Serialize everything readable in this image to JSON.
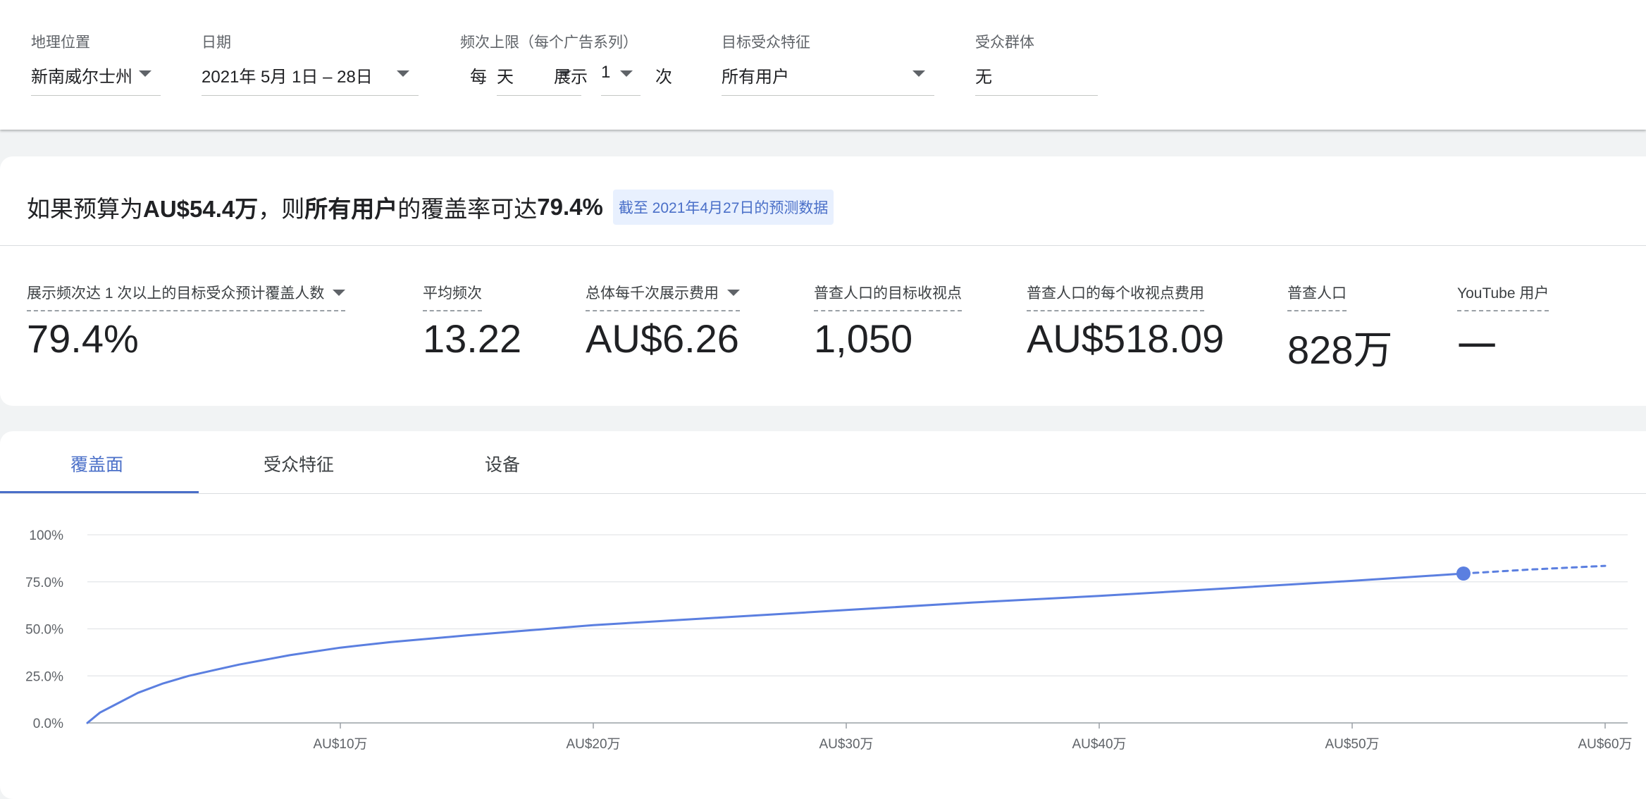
{
  "filters": {
    "geo": {
      "label": "地理位置",
      "value": "新南威尔士州"
    },
    "date": {
      "label": "日期",
      "value": "2021年 5月 1日 – 28日"
    },
    "frequency": {
      "label": "频次上限（每个广告系列）",
      "every": "每",
      "period": "天",
      "show": "展示",
      "count": "1",
      "unit": "次"
    },
    "audience": {
      "label": "目标受众特征",
      "value": "所有用户"
    },
    "segments": {
      "label": "受众群体",
      "value": "无"
    }
  },
  "summary": {
    "prefix": "如果预算为 ",
    "budget": "AU$54.4万",
    "mid": "，则",
    "audience": "所有用户",
    "mid2": "的覆盖率可达 ",
    "rate": "79.4%",
    "badge": "截至 2021年4月27日的预测数据"
  },
  "metrics": [
    {
      "label": "展示频次达 1 次以上的目标受众预计覆盖人数",
      "value": "79.4%"
    },
    {
      "label": "平均频次",
      "value": "13.22"
    },
    {
      "label": "总体每千次展示费用",
      "value": "AU$6.26"
    },
    {
      "label": "普查人口的目标收视点",
      "value": "1,050"
    },
    {
      "label": "普查人口的每个收视点费用",
      "value": "AU$518.09"
    },
    {
      "label": "普查人口",
      "value": "828万"
    },
    {
      "label": "YouTube 用户",
      "value": "一"
    }
  ],
  "tabs": [
    "覆盖面",
    "受众特征",
    "设备"
  ],
  "colors": {
    "accent": "#5b7fe0",
    "badge_bg": "#e8f0fe"
  },
  "chart_data": {
    "type": "line",
    "title": "",
    "xlabel": "",
    "ylabel": "",
    "x_unit": "AU$万",
    "xlim": [
      0,
      60
    ],
    "ylim": [
      0,
      100
    ],
    "x_ticks": [
      10,
      20,
      30,
      40,
      50,
      60
    ],
    "x_tick_labels": [
      "AU$10万",
      "AU$20万",
      "AU$30万",
      "AU$40万",
      "AU$50万",
      "AU$60万"
    ],
    "y_ticks": [
      0,
      25,
      50,
      75,
      100
    ],
    "y_tick_labels": [
      "0.0%",
      "25.0%",
      "50.0%",
      "75.0%",
      "100%"
    ],
    "grid": true,
    "series": [
      {
        "style": "solid",
        "x": [
          0,
          0.5,
          1,
          2,
          3,
          4,
          5,
          6,
          8,
          10,
          12,
          15,
          20,
          25,
          30,
          35,
          40,
          45,
          50,
          54.4
        ],
        "y": [
          0,
          5.5,
          9,
          16,
          21,
          25,
          28,
          31,
          36,
          40,
          43,
          46.5,
          52,
          56,
          60,
          64,
          67.5,
          71.5,
          75.5,
          79.4
        ]
      },
      {
        "style": "dashed",
        "x": [
          54.4,
          57,
          60
        ],
        "y": [
          79.4,
          81.5,
          83.5
        ]
      }
    ],
    "highlight_point": {
      "x": 54.4,
      "y": 79.4
    }
  }
}
